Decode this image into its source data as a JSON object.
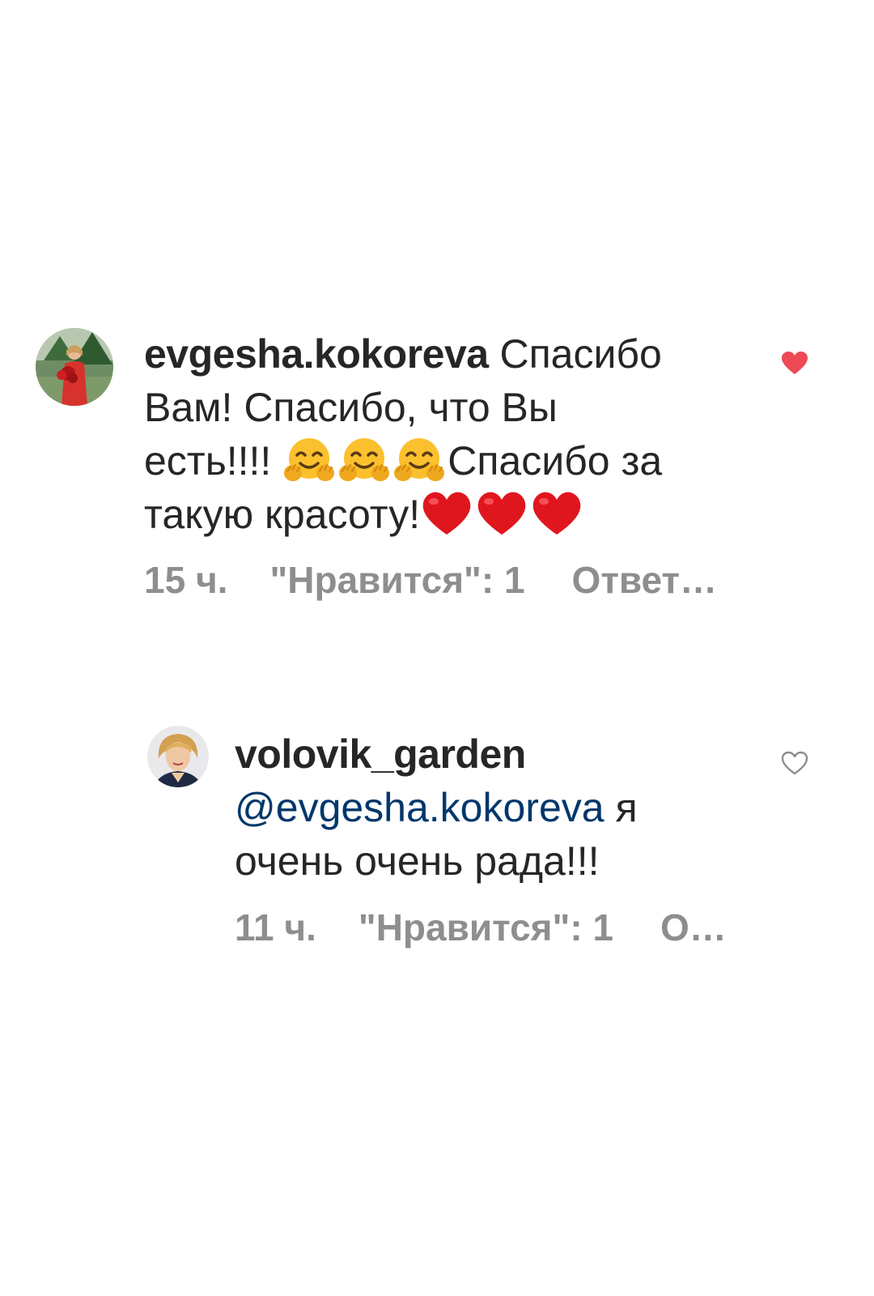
{
  "comments": [
    {
      "username": "evgesha.kokoreva",
      "text_line1": " Спасибо",
      "text_line2": "Вам! Спасибо, что Вы",
      "text_line3_start": "есть!!!! ",
      "text_line3_end": "Спасибо за",
      "text_line4_start": "такую красоту!",
      "emojis": [
        "hugging-face-emoji",
        "hugging-face-emoji",
        "hugging-face-emoji",
        "red-heart-emoji",
        "red-heart-emoji",
        "red-heart-emoji"
      ],
      "time": "15 ч.",
      "likes": "\"Нравится\": 1",
      "reply_label": "Ответ…",
      "liked": true,
      "like_icon": "heart-filled-icon",
      "like_color": "#ed4956"
    },
    {
      "username": "volovik_garden",
      "mention": "@evgesha.kokoreva",
      "text_line2_end": " я",
      "text_line3": "очень очень рада!!!",
      "time": "11 ч.",
      "likes": "\"Нравится\": 1",
      "reply_label": "О…",
      "liked": false,
      "like_icon": "heart-outline-icon"
    }
  ],
  "colors": {
    "text": "#262626",
    "meta": "#8e8e8e",
    "mention": "#00376b",
    "heart": "#ed4956"
  }
}
